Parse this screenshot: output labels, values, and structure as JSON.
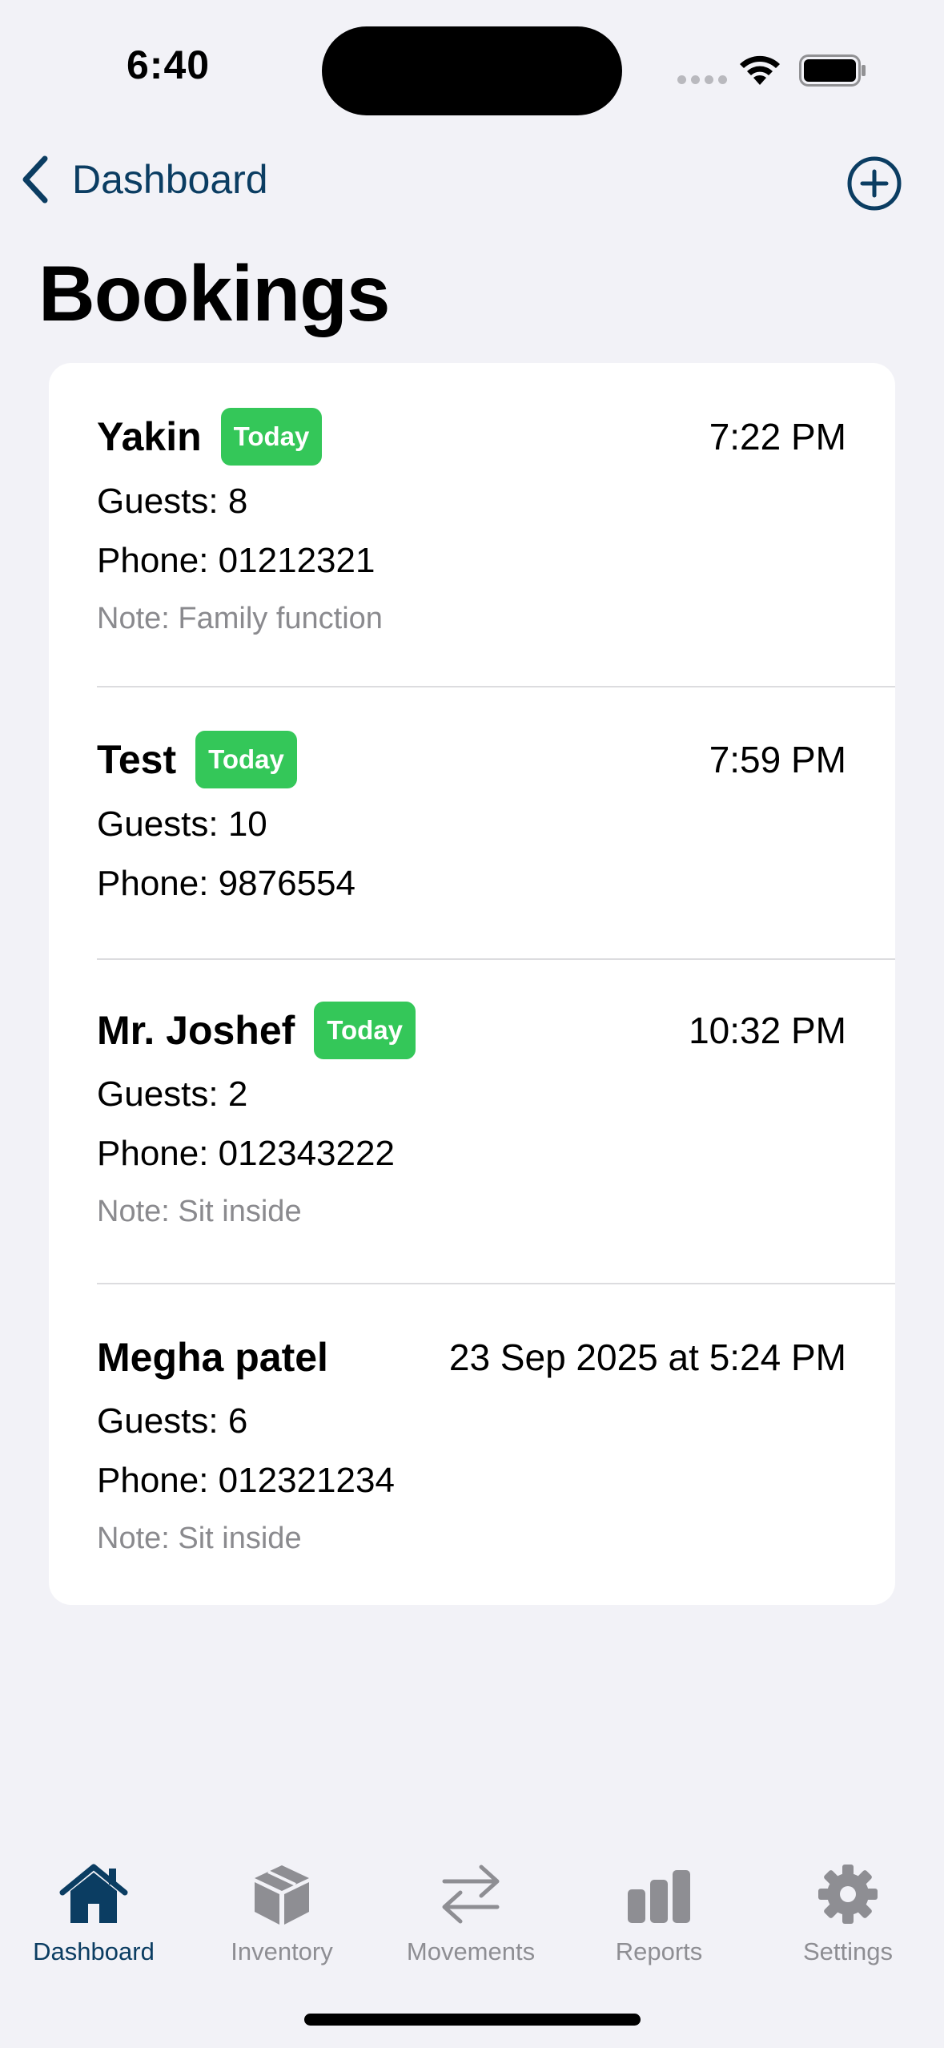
{
  "status_bar": {
    "time": "6:40"
  },
  "nav": {
    "back_label": "Dashboard",
    "title": "Bookings"
  },
  "bookings": [
    {
      "name": "Yakin",
      "badge": "Today",
      "time": "7:22 PM",
      "guests": "Guests: 8",
      "phone": "Phone: 01212321",
      "note": "Note: Family function"
    },
    {
      "name": "Test",
      "badge": "Today",
      "time": "7:59 PM",
      "guests": "Guests: 10",
      "phone": "Phone: 9876554",
      "note": ""
    },
    {
      "name": "Mr. Joshef",
      "badge": "Today",
      "time": "10:32 PM",
      "guests": "Guests: 2",
      "phone": "Phone: 012343222",
      "note": "Note: Sit inside"
    },
    {
      "name": "Megha patel",
      "badge": "",
      "time": "23 Sep 2025 at 5:24 PM",
      "guests": "Guests: 6",
      "phone": "Phone: 012321234",
      "note": "Note: Sit inside"
    }
  ],
  "tabs": [
    {
      "label": "Dashboard",
      "icon": "house-icon",
      "active": true
    },
    {
      "label": "Inventory",
      "icon": "box-icon",
      "active": false
    },
    {
      "label": "Movements",
      "icon": "arrows-icon",
      "active": false
    },
    {
      "label": "Reports",
      "icon": "bar-chart-icon",
      "active": false
    },
    {
      "label": "Settings",
      "icon": "gear-icon",
      "active": false
    }
  ],
  "colors": {
    "accent": "#0b3d62",
    "badge": "#34c759",
    "background": "#f2f2f7",
    "inactive_tab": "#8e8e93"
  }
}
